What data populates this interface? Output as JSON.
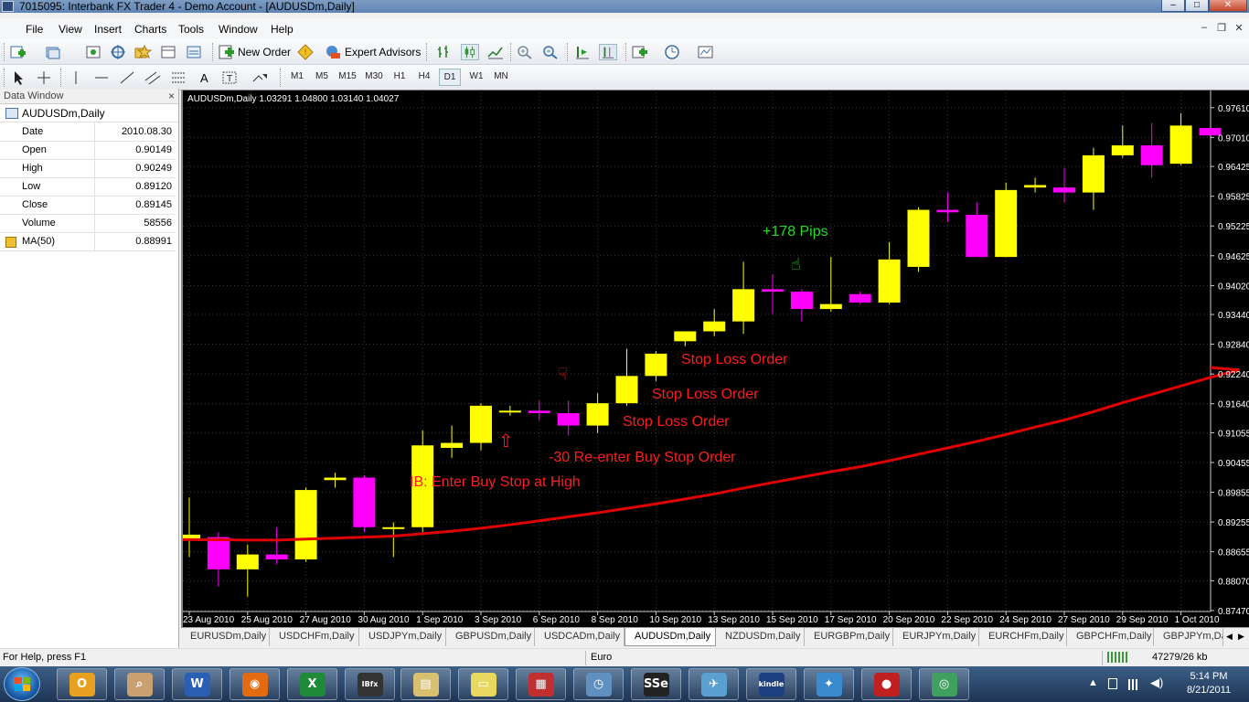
{
  "window": {
    "title": "7015095: Interbank FX Trader 4 - Demo Account - [AUDUSDm,Daily]",
    "min_glyph": "–",
    "max_glyph": "□",
    "close_glyph": "✕"
  },
  "menu": {
    "items": [
      "File",
      "View",
      "Insert",
      "Charts",
      "Tools",
      "Window",
      "Help"
    ],
    "mdi_glyphs": [
      "–",
      "❐",
      "✕"
    ]
  },
  "toolbar": {
    "new_order": "New Order",
    "expert_advisors": "Expert Advisors",
    "timeframes": [
      "M1",
      "M5",
      "M15",
      "M30",
      "H1",
      "H4",
      "D1",
      "W1",
      "MN"
    ],
    "active_timeframe": "D1",
    "text_tool": "A"
  },
  "data_window": {
    "title": "Data Window",
    "close": "×",
    "symbol": "AUDUSDm,Daily",
    "rows": [
      {
        "key": "Date",
        "value": "2010.08.30"
      },
      {
        "key": "Open",
        "value": "0.90149"
      },
      {
        "key": "High",
        "value": "0.90249"
      },
      {
        "key": "Low",
        "value": "0.89120"
      },
      {
        "key": "Close",
        "value": "0.89145"
      },
      {
        "key": "Volume",
        "value": "58556"
      }
    ],
    "indicator": {
      "key": "MA(50)",
      "value": "0.88991"
    }
  },
  "chart": {
    "header": "AUDUSDm,Daily  1.03291 1.04800 1.03140 1.04027",
    "colors": {
      "background": "#000000",
      "bull": "#ffff00",
      "bear": "#ff00ff",
      "wick_bull": "#ffff00",
      "wick_bear": "#ff00ff",
      "ma": "#e00000",
      "grid": "#3a3a3a",
      "axis_text": "#ffffff",
      "annotation": "#ff1c1c",
      "pips": "#22dd22"
    },
    "annotations": [
      {
        "text": "IB: Enter Buy Stop at High",
        "anchor": "bar-8",
        "color": "#ff1c1c"
      },
      {
        "text": "-30 Re-enter Buy Stop Order",
        "anchor": "bar-13",
        "color": "#ff1c1c"
      },
      {
        "text": "Stop Loss Order",
        "anchor": "bar-15",
        "color": "#ff1c1c"
      },
      {
        "text": "Stop Loss Order",
        "anchor": "bar-16",
        "color": "#ff1c1c"
      },
      {
        "text": "Stop Loss Order",
        "anchor": "bar-17",
        "color": "#ff1c1c"
      },
      {
        "text": "+178 Pips",
        "anchor": "bar-21",
        "color": "#22dd22"
      }
    ],
    "markers": [
      {
        "icon": "up-arrow-icon",
        "glyph": "⇧",
        "color": "#ff1c1c",
        "bar": 11,
        "price": 0.9098
      },
      {
        "icon": "thumbs-down-icon",
        "glyph": "☟",
        "color": "#ff1c1c",
        "bar": 13,
        "price": 0.9235
      },
      {
        "icon": "thumbs-up-icon",
        "glyph": "☝",
        "color": "#22dd22",
        "bar": 21,
        "price": 0.945
      }
    ]
  },
  "chart_data": {
    "type": "candlestick",
    "symbol": "AUDUSDm",
    "timeframe": "Daily",
    "ylim": [
      0.8745,
      0.9792
    ],
    "y_ticks": [
      "0.97610",
      "0.97010",
      "0.96425",
      "0.95825",
      "0.95225",
      "0.94625",
      "0.94020",
      "0.93440",
      "0.92840",
      "0.92240",
      "0.91640",
      "0.91055",
      "0.90455",
      "0.89855",
      "0.89255",
      "0.88655",
      "0.88070",
      "0.87470"
    ],
    "x_ticks": [
      {
        "bar": 0,
        "label": "23 Aug 2010"
      },
      {
        "bar": 2,
        "label": "25 Aug 2010"
      },
      {
        "bar": 4,
        "label": "27 Aug 2010"
      },
      {
        "bar": 6,
        "label": "30 Aug 2010"
      },
      {
        "bar": 8,
        "label": "1 Sep 2010"
      },
      {
        "bar": 10,
        "label": "3 Sep 2010"
      },
      {
        "bar": 12,
        "label": "6 Sep 2010"
      },
      {
        "bar": 14,
        "label": "8 Sep 2010"
      },
      {
        "bar": 16,
        "label": "10 Sep 2010"
      },
      {
        "bar": 18,
        "label": "13 Sep 2010"
      },
      {
        "bar": 20,
        "label": "15 Sep 2010"
      },
      {
        "bar": 22,
        "label": "17 Sep 2010"
      },
      {
        "bar": 24,
        "label": "20 Sep 2010"
      },
      {
        "bar": 26,
        "label": "22 Sep 2010"
      },
      {
        "bar": 28,
        "label": "24 Sep 2010"
      },
      {
        "bar": 30,
        "label": "27 Sep 2010"
      },
      {
        "bar": 32,
        "label": "29 Sep 2010"
      },
      {
        "bar": 34,
        "label": "1 Oct 2010"
      }
    ],
    "candles": [
      {
        "o": 0.8888,
        "h": 0.8975,
        "l": 0.8855,
        "c": 0.89
      },
      {
        "o": 0.8895,
        "h": 0.8905,
        "l": 0.8795,
        "c": 0.883
      },
      {
        "o": 0.883,
        "h": 0.888,
        "l": 0.8775,
        "c": 0.886
      },
      {
        "o": 0.886,
        "h": 0.8915,
        "l": 0.884,
        "c": 0.885
      },
      {
        "o": 0.885,
        "h": 0.8995,
        "l": 0.8845,
        "c": 0.899
      },
      {
        "o": 0.901,
        "h": 0.9025,
        "l": 0.8995,
        "c": 0.9015
      },
      {
        "o": 0.9015,
        "h": 0.902,
        "l": 0.8905,
        "c": 0.8915
      },
      {
        "o": 0.8914,
        "h": 0.8925,
        "l": 0.8855,
        "c": 0.8915
      },
      {
        "o": 0.8915,
        "h": 0.911,
        "l": 0.8905,
        "c": 0.908
      },
      {
        "o": 0.9075,
        "h": 0.912,
        "l": 0.9055,
        "c": 0.9085
      },
      {
        "o": 0.9085,
        "h": 0.9165,
        "l": 0.907,
        "c": 0.916
      },
      {
        "o": 0.915,
        "h": 0.916,
        "l": 0.914,
        "c": 0.915
      },
      {
        "o": 0.915,
        "h": 0.917,
        "l": 0.913,
        "c": 0.9145
      },
      {
        "o": 0.9145,
        "h": 0.917,
        "l": 0.91,
        "c": 0.912
      },
      {
        "o": 0.912,
        "h": 0.9185,
        "l": 0.9105,
        "c": 0.9165
      },
      {
        "o": 0.9165,
        "h": 0.9275,
        "l": 0.916,
        "c": 0.922
      },
      {
        "o": 0.922,
        "h": 0.927,
        "l": 0.921,
        "c": 0.9265
      },
      {
        "o": 0.929,
        "h": 0.931,
        "l": 0.928,
        "c": 0.931
      },
      {
        "o": 0.931,
        "h": 0.9355,
        "l": 0.93,
        "c": 0.933
      },
      {
        "o": 0.933,
        "h": 0.945,
        "l": 0.9305,
        "c": 0.9395
      },
      {
        "o": 0.9395,
        "h": 0.9425,
        "l": 0.9345,
        "c": 0.939
      },
      {
        "o": 0.939,
        "h": 0.9395,
        "l": 0.933,
        "c": 0.9355
      },
      {
        "o": 0.9355,
        "h": 0.946,
        "l": 0.935,
        "c": 0.9365
      },
      {
        "o": 0.9385,
        "h": 0.939,
        "l": 0.9365,
        "c": 0.9368
      },
      {
        "o": 0.9368,
        "h": 0.949,
        "l": 0.9365,
        "c": 0.9455
      },
      {
        "o": 0.944,
        "h": 0.956,
        "l": 0.943,
        "c": 0.9555
      },
      {
        "o": 0.9555,
        "h": 0.959,
        "l": 0.953,
        "c": 0.955
      },
      {
        "o": 0.9545,
        "h": 0.957,
        "l": 0.946,
        "c": 0.946
      },
      {
        "o": 0.946,
        "h": 0.961,
        "l": 0.946,
        "c": 0.9595
      },
      {
        "o": 0.96,
        "h": 0.962,
        "l": 0.959,
        "c": 0.9605
      },
      {
        "o": 0.96,
        "h": 0.964,
        "l": 0.957,
        "c": 0.959
      },
      {
        "o": 0.959,
        "h": 0.968,
        "l": 0.9555,
        "c": 0.9665
      },
      {
        "o": 0.9665,
        "h": 0.9725,
        "l": 0.966,
        "c": 0.9685
      },
      {
        "o": 0.9685,
        "h": 0.973,
        "l": 0.962,
        "c": 0.9645
      },
      {
        "o": 0.9648,
        "h": 0.975,
        "l": 0.9645,
        "c": 0.9725
      },
      {
        "o": 0.972,
        "h": 0.973,
        "l": 0.97,
        "c": 0.9705
      }
    ],
    "ma50": [
      0.889,
      0.889,
      0.8889,
      0.8889,
      0.8891,
      0.8893,
      0.8895,
      0.8897,
      0.8902,
      0.8907,
      0.8913,
      0.892,
      0.8928,
      0.8936,
      0.8944,
      0.8953,
      0.8962,
      0.8972,
      0.8982,
      0.8994,
      0.9005,
      0.9016,
      0.9027,
      0.9037,
      0.9049,
      0.9062,
      0.9075,
      0.9088,
      0.9102,
      0.9117,
      0.9131,
      0.9148,
      0.9166,
      0.9183,
      0.92,
      0.9217,
      0.9232
    ]
  },
  "tabs": {
    "items": [
      "EURUSDm,Daily",
      "USDCHFm,Daily",
      "USDJPYm,Daily",
      "GBPUSDm,Daily",
      "USDCADm,Daily",
      "AUDUSDm,Daily",
      "NZDUSDm,Daily",
      "EURGBPm,Daily",
      "EURJPYm,Daily",
      "EURCHFm,Daily",
      "GBPCHFm,Daily",
      "GBPJPYm,Daily"
    ],
    "active": "AUDUSDm,Daily",
    "left_arrow": "◀",
    "right_arrow": "▶"
  },
  "status": {
    "help": "For Help, press F1",
    "profile": "Euro",
    "traffic": "47279/26 kb"
  },
  "taskbar": {
    "apps": [
      {
        "icon": "outlook-icon",
        "glyph": "O",
        "color": "#e8a020"
      },
      {
        "icon": "explorer-search-icon",
        "glyph": "⌕",
        "color": "#c9a070"
      },
      {
        "icon": "word-icon",
        "glyph": "W",
        "color": "#2b5fb4"
      },
      {
        "icon": "firefox-icon",
        "glyph": "◉",
        "color": "#e46a12"
      },
      {
        "icon": "excel-icon",
        "glyph": "X",
        "color": "#1f8a3a"
      },
      {
        "icon": "ibfx-icon",
        "glyph": "IBfx",
        "color": "#333333"
      },
      {
        "icon": "library-icon",
        "glyph": "▤",
        "color": "#d8c070"
      },
      {
        "icon": "notes-icon",
        "glyph": "▭",
        "color": "#e8d860"
      },
      {
        "icon": "calculator-icon",
        "glyph": "▦",
        "color": "#c03030"
      },
      {
        "icon": "clock-app-icon",
        "glyph": "◷",
        "color": "#6090c0"
      },
      {
        "icon": "sse-icon",
        "glyph": "SSe",
        "color": "#222222"
      },
      {
        "icon": "bird-app-icon",
        "glyph": "✈",
        "color": "#5aa0d0"
      },
      {
        "icon": "kindle-icon",
        "glyph": "kindle",
        "color": "#1e4080"
      },
      {
        "icon": "twitter-icon",
        "glyph": "✦",
        "color": "#3a8ad0"
      },
      {
        "icon": "apple-app-icon",
        "glyph": "●",
        "color": "#c02020"
      },
      {
        "icon": "sync-app-icon",
        "glyph": "◎",
        "color": "#40a060"
      }
    ],
    "tray_up": "▲",
    "time": "5:14 PM",
    "date": "8/21/2011"
  }
}
